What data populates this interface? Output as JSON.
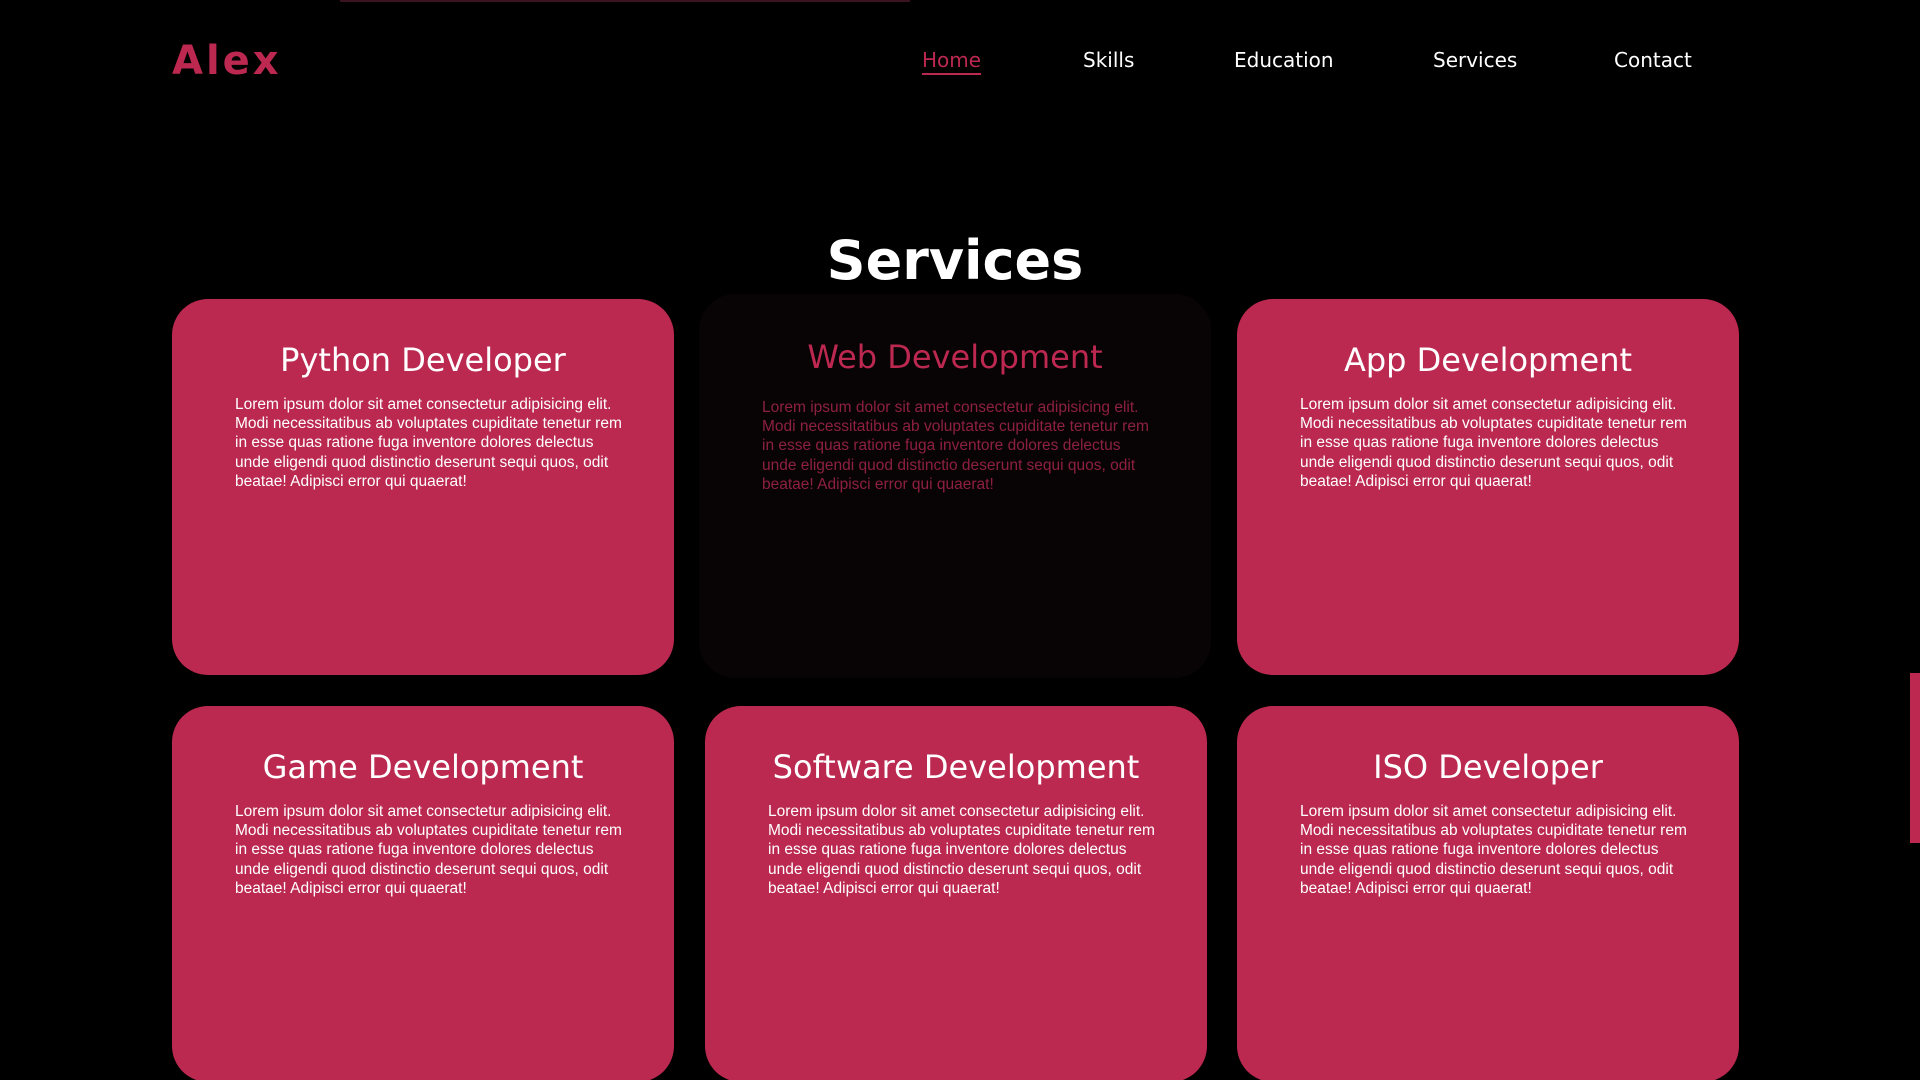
{
  "brand": {
    "logo": "Alex",
    "accent_color": "#bd2850",
    "background_color": "#000000"
  },
  "nav": {
    "items": [
      {
        "label": "Home",
        "active": true
      },
      {
        "label": "Skills",
        "active": false
      },
      {
        "label": "Education",
        "active": false
      },
      {
        "label": "Services",
        "active": false
      },
      {
        "label": "Contact",
        "active": false
      }
    ]
  },
  "services": {
    "title": "Services",
    "cards": [
      {
        "title": "Python Developer",
        "text": "Lorem ipsum dolor sit amet consectetur adipisicing elit. Modi necessitatibus ab voluptates cupiditate tenetur rem in esse quas ratione fuga inventore dolores delectus unde eligendi quod distinctio deserunt sequi quos, odit beatae! Adipisci error qui quaerat!"
      },
      {
        "title": "Web Development",
        "text": "Lorem ipsum dolor sit amet consectetur adipisicing elit. Modi necessitatibus ab voluptates cupiditate tenetur rem in esse quas ratione fuga inventore dolores delectus unde eligendi quod distinctio deserunt sequi quos, odit beatae! Adipisci error qui quaerat!"
      },
      {
        "title": "App Development",
        "text": "Lorem ipsum dolor sit amet consectetur adipisicing elit. Modi necessitatibus ab voluptates cupiditate tenetur rem in esse quas ratione fuga inventore dolores delectus unde eligendi quod distinctio deserunt sequi quos, odit beatae! Adipisci error qui quaerat!"
      },
      {
        "title": "Game Development",
        "text": "Lorem ipsum dolor sit amet consectetur adipisicing elit. Modi necessitatibus ab voluptates cupiditate tenetur rem in esse quas ratione fuga inventore dolores delectus unde eligendi quod distinctio deserunt sequi quos, odit beatae! Adipisci error qui quaerat!"
      },
      {
        "title": "Software Development",
        "text": "Lorem ipsum dolor sit amet consectetur adipisicing elit. Modi necessitatibus ab voluptates cupiditate tenetur rem in esse quas ratione fuga inventore dolores delectus unde eligendi quod distinctio deserunt sequi quos, odit beatae! Adipisci error qui quaerat!"
      },
      {
        "title": "ISO Developer",
        "text": "Lorem ipsum dolor sit amet consectetur adipisicing elit. Modi necessitatibus ab voluptates cupiditate tenetur rem in esse quas ratione fuga inventore dolores delectus unde eligendi quod distinctio deserunt sequi quos, odit beatae! Adipisci error qui quaerat!"
      }
    ]
  }
}
